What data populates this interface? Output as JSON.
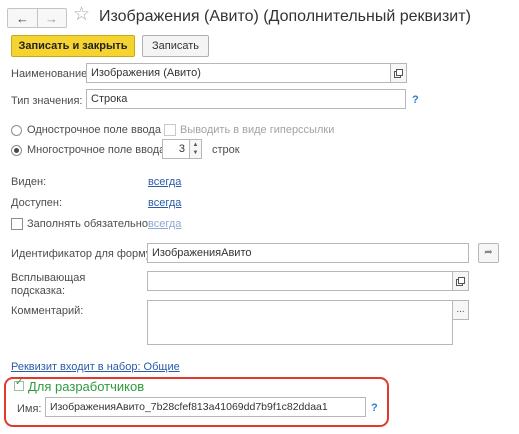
{
  "window": {
    "title": "Изображения (Авито) (Дополнительный реквизит)"
  },
  "toolbar": {
    "save_close_label": "Записать и закрыть",
    "save_label": "Записать"
  },
  "form": {
    "name": {
      "label": "Наименование:",
      "value": "Изображения (Авито)"
    },
    "value_type": {
      "label": "Тип значения:",
      "value": "Строка",
      "help": "?"
    },
    "single_line": {
      "label": "Однострочное поле ввода",
      "selected": false
    },
    "hyperlink": {
      "label": "Выводить в виде гиперссылки",
      "checked": false
    },
    "multi_line": {
      "label": "Многострочное поле ввода",
      "selected": true,
      "rows": "3",
      "rows_suffix": "строк"
    },
    "visible": {
      "label": "Виден:",
      "value": "всегда"
    },
    "available": {
      "label": "Доступен:",
      "value": "всегда"
    },
    "required": {
      "label": "Заполнять обязательно:",
      "value": "всегда",
      "checked": false
    },
    "formula_id": {
      "label": "Идентификатор для формул:",
      "value": "ИзображенияАвито"
    },
    "tooltip": {
      "label_line1": "Всплывающая",
      "label_line2": "подсказка:",
      "value": ""
    },
    "comment": {
      "label": "Комментарий:",
      "value": "",
      "button": "..."
    },
    "set_link": "Реквизит входит в набор: Общие"
  },
  "developers": {
    "title": "Для разработчиков",
    "checked": true,
    "name_label": "Имя:",
    "name_value": "ИзображенияАвито_7b28cfef813a41069dd7b9f1c82ddaa1",
    "help": "?"
  },
  "colors": {
    "accent_yellow": "#f5d432",
    "dev_green": "#2e9b3d",
    "highlight_red": "#e03a2f",
    "link_blue": "#2a5aa8"
  }
}
